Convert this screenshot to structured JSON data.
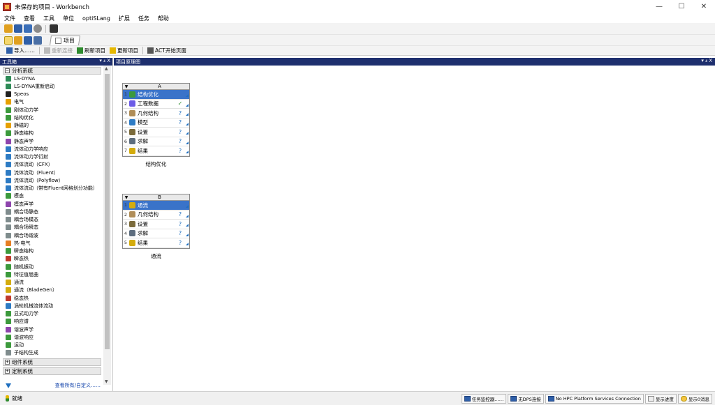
{
  "window": {
    "title": "未保存的项目 - Workbench",
    "controls": [
      "—",
      "☐",
      "✕"
    ]
  },
  "menu": [
    "文件",
    "查看",
    "工具",
    "单位",
    "optiSLang",
    "扩展",
    "任务",
    "帮助"
  ],
  "project_tab": "项目",
  "toolbar": {
    "import": "导入……",
    "reconnect": "重新连接",
    "refresh_project": "刷新项目",
    "update_project": "更新项目",
    "act_start": "ACT开始页面"
  },
  "toolbox": {
    "title": "工具箱",
    "controls": "▾ ₄ X",
    "sections": {
      "analysis": "分析系统",
      "component": "组件系统",
      "custom": "定制系统"
    },
    "items": [
      {
        "label": "LS-DYNA",
        "color": "#2e8b57"
      },
      {
        "label": "LS-DYNA重新启动",
        "color": "#2e8b57"
      },
      {
        "label": "Speos",
        "color": "#222222"
      },
      {
        "label": "电气",
        "color": "#e6a000"
      },
      {
        "label": "刚体动力学",
        "color": "#3c9a3c"
      },
      {
        "label": "结构优化",
        "color": "#3c9a3c"
      },
      {
        "label": "静磁的",
        "color": "#e6a000"
      },
      {
        "label": "静态结构",
        "color": "#3c9a3c"
      },
      {
        "label": "静态声学",
        "color": "#8e44ad"
      },
      {
        "label": "流体动力学响应",
        "color": "#2d7bc4"
      },
      {
        "label": "流体动力学衍射",
        "color": "#2d7bc4"
      },
      {
        "label": "流体流动（CFX）",
        "color": "#2d7bc4"
      },
      {
        "label": "流体流动（Fluent）",
        "color": "#2d7bc4"
      },
      {
        "label": "流体流动（Polyflow）",
        "color": "#2d7bc4"
      },
      {
        "label": "流体流动（带有Fluent网格划分功能）",
        "color": "#2d7bc4"
      },
      {
        "label": "模态",
        "color": "#3c9a3c"
      },
      {
        "label": "模态声学",
        "color": "#8e44ad"
      },
      {
        "label": "耦合场静态",
        "color": "#7f8c8d"
      },
      {
        "label": "耦合场模态",
        "color": "#7f8c8d"
      },
      {
        "label": "耦合场瞬态",
        "color": "#7f8c8d"
      },
      {
        "label": "耦合场谐波",
        "color": "#7f8c8d"
      },
      {
        "label": "热-电气",
        "color": "#e67e22"
      },
      {
        "label": "瞬态结构",
        "color": "#3c9a3c"
      },
      {
        "label": "瞬态热",
        "color": "#c0392b"
      },
      {
        "label": "随机振动",
        "color": "#3c9a3c"
      },
      {
        "label": "特征值屈曲",
        "color": "#3c9a3c"
      },
      {
        "label": "通流",
        "color": "#d4ac0d"
      },
      {
        "label": "通流（BladeGen）",
        "color": "#d4ac0d"
      },
      {
        "label": "稳态热",
        "color": "#c0392b"
      },
      {
        "label": "涡轮机械流体流动",
        "color": "#2d7bc4"
      },
      {
        "label": "显式动力学",
        "color": "#3c9a3c"
      },
      {
        "label": "响应谱",
        "color": "#3c9a3c"
      },
      {
        "label": "谐波声学",
        "color": "#8e44ad"
      },
      {
        "label": "谐波响应",
        "color": "#3c9a3c"
      },
      {
        "label": "运动",
        "color": "#3c9a3c"
      },
      {
        "label": "子结构生成",
        "color": "#7f8c8d"
      }
    ],
    "view_all": "查看所有/自定义……"
  },
  "schematic": {
    "title": "项目原理图",
    "controls": "▾ ₄ X",
    "blocks": [
      {
        "column": "A",
        "caption": "结构优化",
        "rows": [
          {
            "num": "1",
            "label": "结构优化",
            "status": "",
            "color": "#3c9a3c",
            "selected": true
          },
          {
            "num": "2",
            "label": "工程数据",
            "status": "✓",
            "color": "#6c5ce7",
            "selected": false
          },
          {
            "num": "3",
            "label": "几何结构",
            "status": "?",
            "color": "#b08d57",
            "selected": false
          },
          {
            "num": "4",
            "label": "模型",
            "status": "?",
            "color": "#2d7bc4",
            "selected": false
          },
          {
            "num": "5",
            "label": "设置",
            "status": "?",
            "color": "#7a6a3a",
            "selected": false
          },
          {
            "num": "6",
            "label": "求解",
            "status": "?",
            "color": "#5d6d7e",
            "selected": false
          },
          {
            "num": "7",
            "label": "结果",
            "status": "?",
            "color": "#d4ac0d",
            "selected": false
          }
        ]
      },
      {
        "column": "B",
        "caption": "通流",
        "rows": [
          {
            "num": "1",
            "label": "通流",
            "status": "",
            "color": "#d4ac0d",
            "selected": true
          },
          {
            "num": "2",
            "label": "几何结构",
            "status": "?",
            "color": "#b08d57",
            "selected": false
          },
          {
            "num": "3",
            "label": "设置",
            "status": "?",
            "color": "#7a6a3a",
            "selected": false
          },
          {
            "num": "4",
            "label": "求解",
            "status": "?",
            "color": "#5d6d7e",
            "selected": false
          },
          {
            "num": "5",
            "label": "结果",
            "status": "?",
            "color": "#d4ac0d",
            "selected": false
          }
        ]
      }
    ]
  },
  "status": {
    "ready": "就绪",
    "task_monitor": "任务监控器……",
    "no_dps": "无DPS连接",
    "no_hpc": "No HPC Platform Services Connection",
    "show_progress": "显示进度",
    "show_messages": "显示0消息"
  }
}
